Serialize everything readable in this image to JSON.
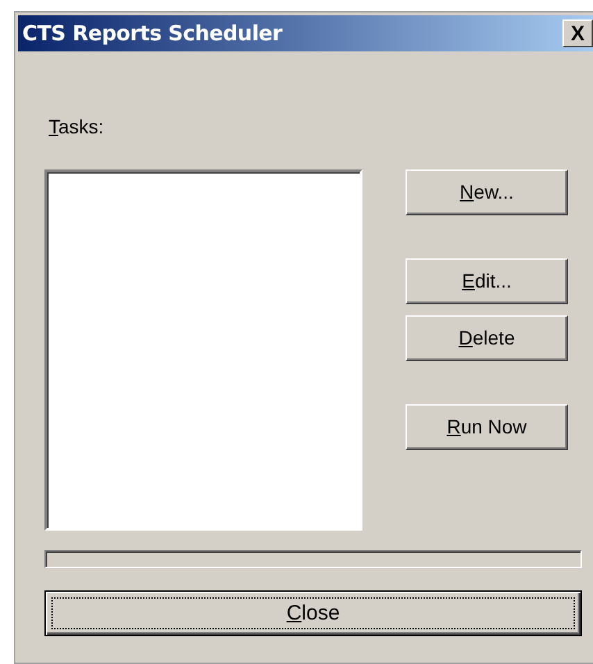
{
  "window": {
    "title": "CTS Reports Scheduler",
    "close_glyph": "X"
  },
  "tasks_label": {
    "text": "Tasks:",
    "underline_first": true
  },
  "buttons": [
    {
      "label": "New...",
      "underline_first": true
    },
    {
      "label": "Edit...",
      "underline_first": true
    },
    {
      "label": "Delete",
      "underline_first": true
    },
    {
      "label": "Run Now",
      "underline_first": true
    }
  ],
  "progress": {
    "level": 0
  },
  "close_button": {
    "label": "Close",
    "underline_first": true,
    "default": true
  }
}
